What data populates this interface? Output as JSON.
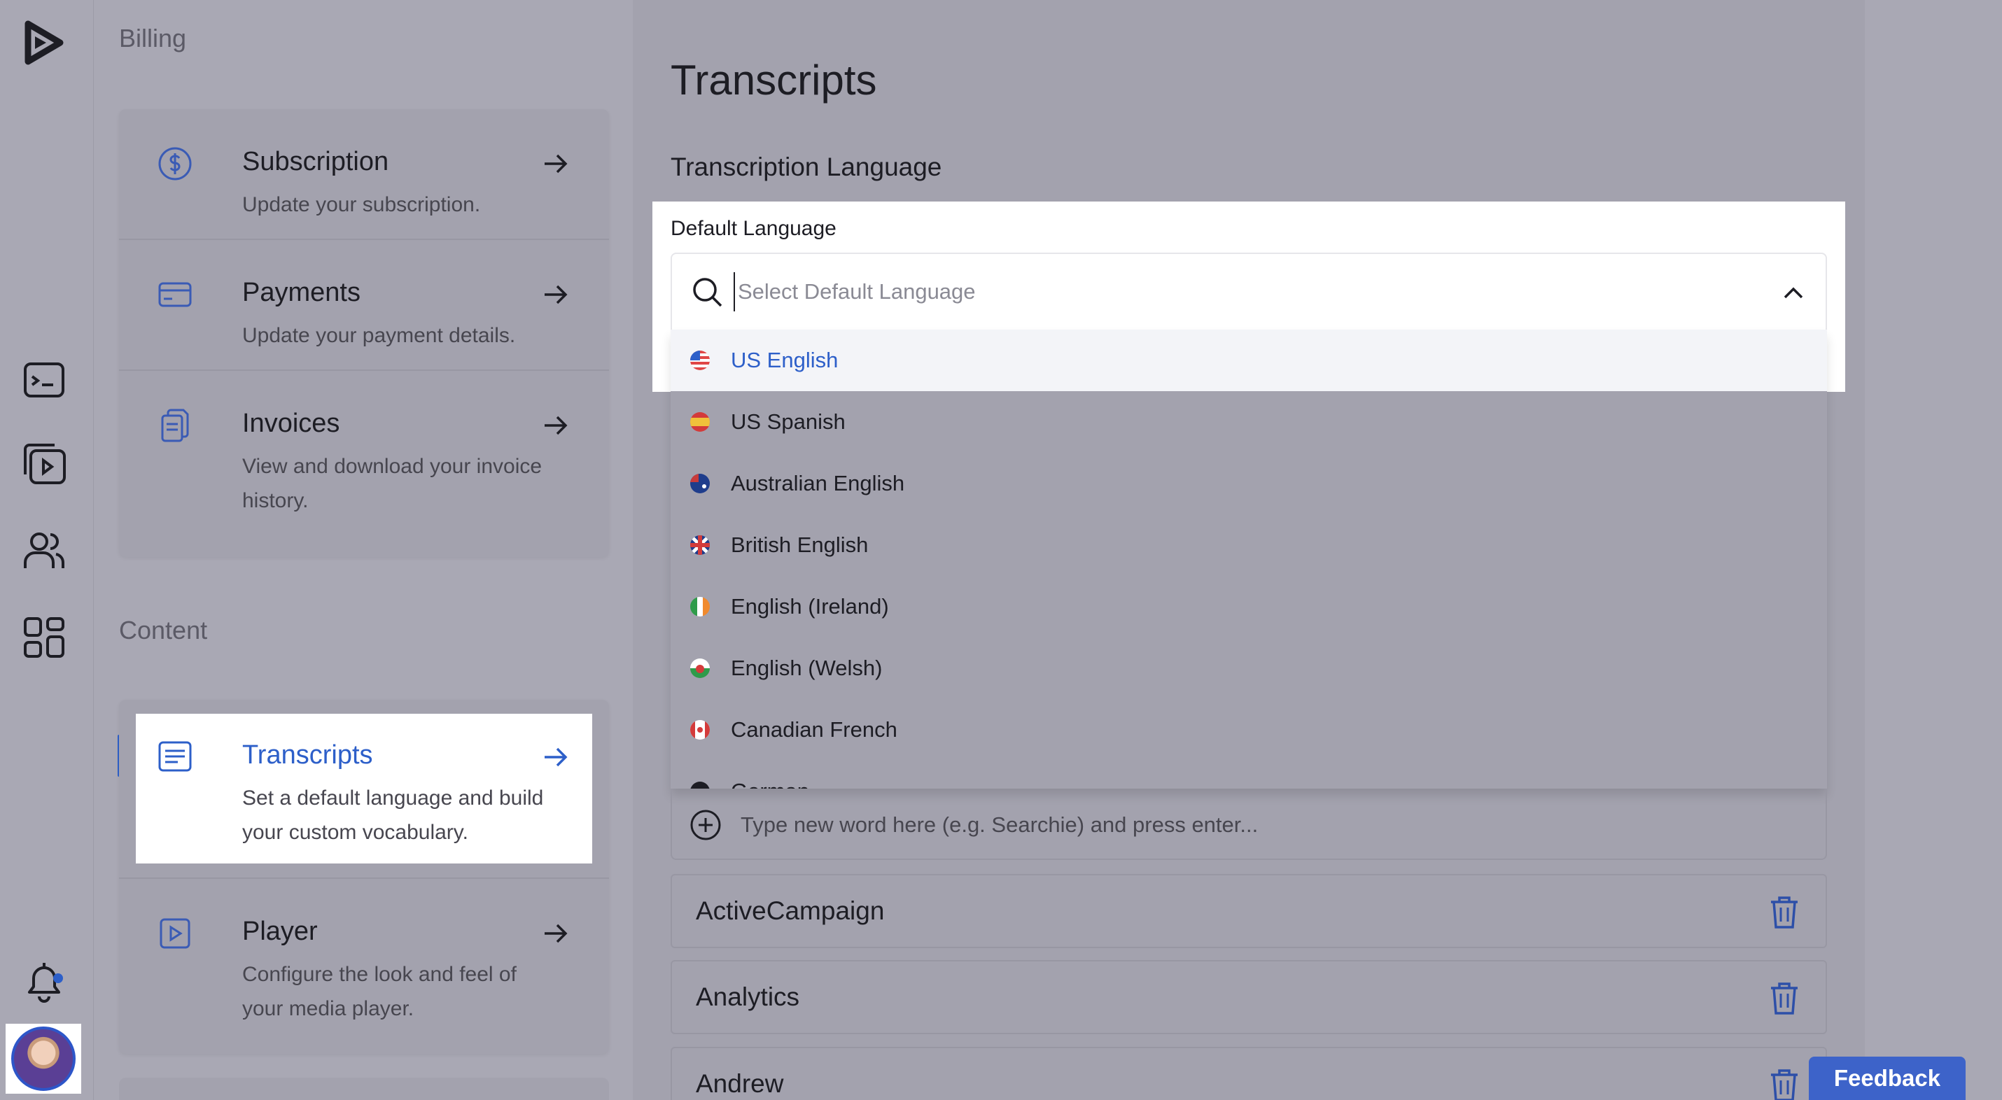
{
  "sidebar": {
    "billing_title": "Billing",
    "content_title": "Content",
    "billing_items": [
      {
        "title": "Subscription",
        "desc": "Update your subscription.",
        "icon": "dollar-icon"
      },
      {
        "title": "Payments",
        "desc": "Update your payment details.",
        "icon": "credit-card-icon"
      },
      {
        "title": "Invoices",
        "desc": "View and download your invoice history.",
        "icon": "invoice-icon"
      }
    ],
    "content_items": [
      {
        "title": "Transcripts",
        "desc": "Set a default language and build your custom vocabulary.",
        "icon": "transcript-icon",
        "active": true
      },
      {
        "title": "Player",
        "desc": "Configure the look and feel of your media player.",
        "icon": "player-icon"
      }
    ]
  },
  "main": {
    "title": "Transcripts",
    "subtitle": "Transcription Language",
    "default_language_label": "Default Language",
    "select_placeholder": "Select Default Language",
    "languages": [
      {
        "label": "US English",
        "flag": "us-flag-icon",
        "highlighted": true
      },
      {
        "label": "US Spanish",
        "flag": "spanish-flag-icon"
      },
      {
        "label": "Australian English",
        "flag": "australia-flag-icon"
      },
      {
        "label": "British English",
        "flag": "uk-flag-icon"
      },
      {
        "label": "English (Ireland)",
        "flag": "ireland-flag-icon"
      },
      {
        "label": "English (Welsh)",
        "flag": "wales-flag-icon"
      },
      {
        "label": "Canadian French",
        "flag": "canada-flag-icon"
      },
      {
        "label": "German",
        "flag": "germany-flag-icon"
      }
    ],
    "new_word_placeholder": "Type new word here (e.g. Searchie) and press enter...",
    "vocabulary": [
      "ActiveCampaign",
      "Analytics",
      "Andrew"
    ]
  },
  "feedback_label": "Feedback",
  "colors": {
    "accent": "#2d5fc9",
    "overlay_bg": "#a9a8b4",
    "feedback_bg": "#3d63c9"
  }
}
